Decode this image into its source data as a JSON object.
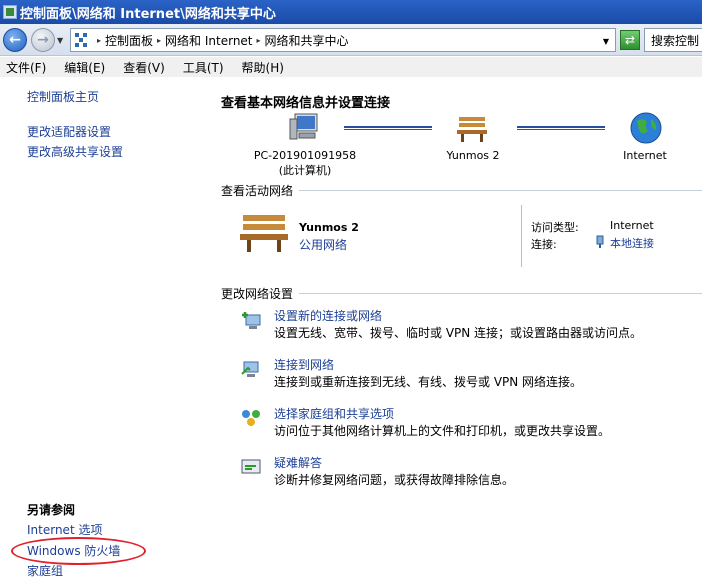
{
  "window": {
    "title": "控制面板\\网络和 Internet\\网络和共享中心"
  },
  "address": {
    "crumbs": [
      "控制面板",
      "网络和 Internet",
      "网络和共享中心"
    ],
    "search_placeholder": "搜索控制"
  },
  "menu": [
    "文件(F)",
    "编辑(E)",
    "查看(V)",
    "工具(T)",
    "帮助(H)"
  ],
  "sidebar": {
    "home": "控制面板主页",
    "links": [
      "更改适配器设置",
      "更改高级共享设置"
    ],
    "see_also_title": "另请参阅",
    "see_also": [
      "Internet 选项",
      "Windows 防火墙",
      "家庭组"
    ]
  },
  "main": {
    "title": "查看基本网络信息并设置连接",
    "map": {
      "computer_name": "PC-201901091958",
      "computer_sub": "(此计算机)",
      "network_name": "Yunmos  2",
      "internet": "Internet"
    },
    "active_title": "查看活动网络",
    "active": {
      "name": "Yunmos  2",
      "type": "公用网络",
      "access_label": "访问类型:",
      "access_value": "Internet",
      "conn_label": "连接:",
      "conn_value": "本地连接"
    },
    "change_title": "更改网络设置",
    "tasks": [
      {
        "title": "设置新的连接或网络",
        "desc": "设置无线、宽带、拨号、临时或 VPN 连接；或设置路由器或访问点。"
      },
      {
        "title": "连接到网络",
        "desc": "连接到或重新连接到无线、有线、拨号或 VPN 网络连接。"
      },
      {
        "title": "选择家庭组和共享选项",
        "desc": "访问位于其他网络计算机上的文件和打印机，或更改共享设置。"
      },
      {
        "title": "疑难解答",
        "desc": "诊断并修复网络问题，或获得故障排除信息。"
      }
    ]
  }
}
